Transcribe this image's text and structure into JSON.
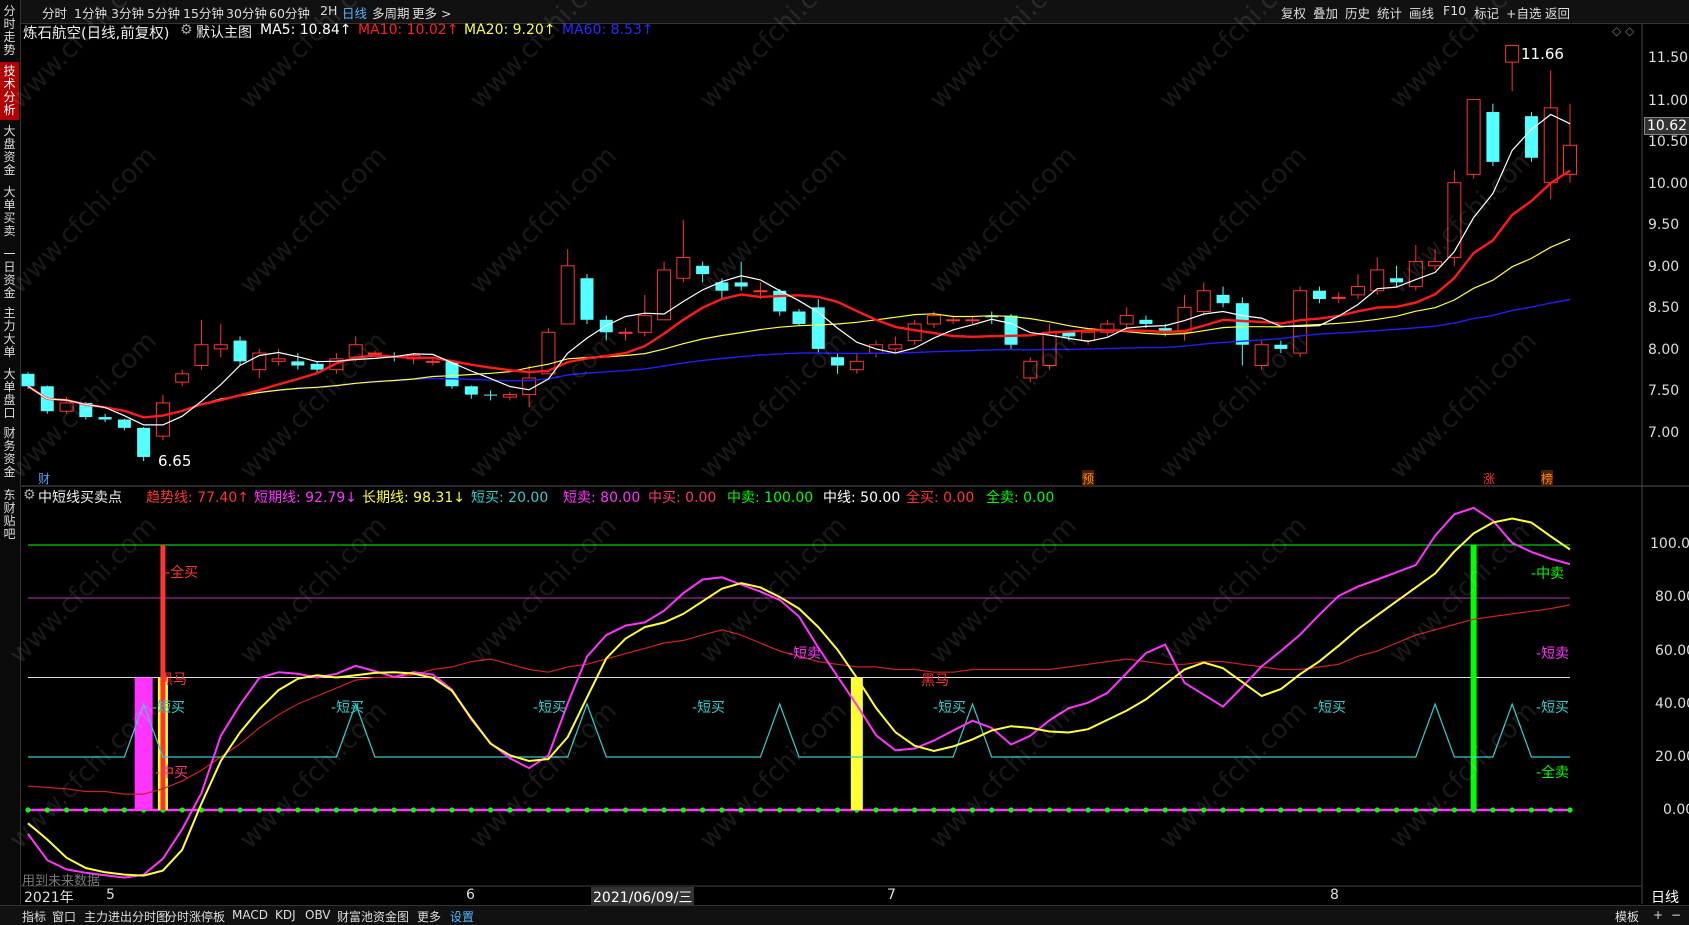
{
  "toolbar": {
    "items": [
      {
        "label": "分时"
      },
      {
        "label": "1分钟"
      },
      {
        "label": "3分钟"
      },
      {
        "label": "5分钟"
      },
      {
        "label": "15分钟"
      },
      {
        "label": "30分钟"
      },
      {
        "label": "60分钟"
      },
      {
        "label": "2H"
      },
      {
        "label": "日线"
      },
      {
        "label": "多周期"
      },
      {
        "label": "更多 >"
      }
    ],
    "right_items": [
      {
        "label": "复权"
      },
      {
        "label": "叠加"
      },
      {
        "label": "历史"
      },
      {
        "label": "统计"
      },
      {
        "label": "画线"
      },
      {
        "label": "F10"
      },
      {
        "label": "标记"
      },
      {
        "label": "+自选"
      },
      {
        "label": "返回"
      }
    ]
  },
  "sidebar": {
    "tabs": [
      {
        "label": "分时走势"
      },
      {
        "label": "技术分析"
      },
      {
        "label": "大盘资金"
      },
      {
        "label": "大单买卖"
      },
      {
        "label": "一日资金"
      },
      {
        "label": "主力大单"
      },
      {
        "label": "大单盘口"
      },
      {
        "label": "财务资金"
      },
      {
        "label": "东财贴吧"
      }
    ]
  },
  "main_chart": {
    "stock_name": "炼石航空(日线,前复权)",
    "indicator_name": "默认主图",
    "ma5": "MA5: 10.84↑",
    "ma10": "MA10: 10.02↑",
    "ma20": "MA20: 9.20↑",
    "ma60": "MA60: 8.53↑",
    "high_label": "11.66",
    "low_label": "6.65",
    "current_price": "10.62",
    "markers": [
      "财",
      "预",
      "涨",
      "榜"
    ],
    "y_ticks": [
      "11.50",
      "11.00",
      "10.50",
      "10.00",
      "9.50",
      "9.00",
      "8.50",
      "8.00",
      "7.50",
      "7.00"
    ]
  },
  "sub_chart": {
    "name": "中短线买卖点",
    "trend": "趋势线: 77.40↑",
    "short": "短期线: 92.79↓",
    "long": "长期线: 98.31↓",
    "short_buy": "短买: 20.00",
    "short_sell": "短卖: 80.00",
    "mid_buy": "中买: 0.00",
    "mid_sell": "中卖: 100.00",
    "mid_line": "中线: 50.00",
    "all_buy": "全买: 0.00",
    "all_sell": "全卖: 0.00",
    "y_ticks": [
      "100.00",
      "80.00",
      "60.00",
      "40.00",
      "20.00",
      "0.00"
    ],
    "annotations": {
      "quanmai": "全买",
      "heima": "黑马",
      "duanmai": "短买",
      "zhongmai": "中买",
      "duanmai_mai": "短卖",
      "zhongmai_mai": "中卖",
      "quanmai_mai": "全卖"
    },
    "future_note": "用到未来数据"
  },
  "x_axis": {
    "labels": [
      "2021年",
      "5",
      "6",
      "2021/06/09/三",
      "7",
      "8"
    ]
  },
  "bottom_tabs": [
    {
      "label": "指标"
    },
    {
      "label": "窗口"
    },
    {
      "label": "主力进出分时图"
    },
    {
      "label": "分时涨停板"
    },
    {
      "label": "MACD"
    },
    {
      "label": "KDJ"
    },
    {
      "label": "OBV"
    },
    {
      "label": "财富池资金图"
    },
    {
      "label": "更多"
    },
    {
      "label": "设置"
    }
  ],
  "bottom_right": {
    "template": "模板",
    "period": "日线",
    "plus": "+",
    "minus": "−"
  },
  "colors": {
    "up": "#ff3232",
    "down": "#54ffff",
    "ma5": "#ffffff",
    "ma10": "#ff1a1a",
    "ma20": "#ffff33",
    "ma60": "#1e1eff",
    "trend": "#ff3333",
    "short": "#ff33ff",
    "long": "#ffff33",
    "cyan": "#33cccc",
    "green": "#00ff00",
    "magenta_line": "#c030c0"
  },
  "chart_data": {
    "type": "candlestick",
    "price_range": [
      6.6,
      11.75
    ],
    "candles": [
      [
        7.7,
        7.55,
        7.72,
        7.52
      ],
      [
        7.55,
        7.25,
        7.56,
        7.22
      ],
      [
        7.25,
        7.35,
        7.42,
        7.22
      ],
      [
        7.35,
        7.18,
        7.36,
        7.15
      ],
      [
        7.18,
        7.15,
        7.22,
        7.12
      ],
      [
        7.15,
        7.05,
        7.16,
        7.02
      ],
      [
        7.05,
        6.7,
        7.06,
        6.65
      ],
      [
        6.95,
        7.35,
        7.45,
        6.9
      ],
      [
        7.6,
        7.7,
        7.75,
        7.55
      ],
      [
        7.8,
        8.05,
        8.35,
        7.75
      ],
      [
        8.0,
        8.05,
        8.3,
        7.9
      ],
      [
        8.1,
        7.85,
        8.15,
        7.8
      ],
      [
        7.75,
        7.95,
        8.0,
        7.65
      ],
      [
        7.85,
        7.88,
        8.0,
        7.8
      ],
      [
        7.85,
        7.8,
        7.95,
        7.75
      ],
      [
        7.82,
        7.75,
        7.85,
        7.7
      ],
      [
        7.75,
        7.88,
        7.95,
        7.7
      ],
      [
        7.9,
        8.05,
        8.15,
        7.85
      ],
      [
        7.95,
        7.95,
        7.98,
        7.9
      ],
      [
        7.92,
        7.9,
        7.96,
        7.85
      ],
      [
        7.88,
        7.92,
        7.95,
        7.82
      ],
      [
        7.85,
        7.85,
        7.88,
        7.8
      ],
      [
        7.85,
        7.55,
        7.86,
        7.52
      ],
      [
        7.55,
        7.45,
        7.56,
        7.4
      ],
      [
        7.45,
        7.44,
        7.5,
        7.38
      ],
      [
        7.42,
        7.45,
        7.48,
        7.38
      ],
      [
        7.45,
        7.65,
        7.8,
        7.3
      ],
      [
        7.7,
        8.2,
        8.25,
        7.7
      ],
      [
        8.3,
        9.0,
        9.2,
        8.3
      ],
      [
        8.85,
        8.35,
        8.9,
        8.3
      ],
      [
        8.35,
        8.2,
        8.4,
        8.1
      ],
      [
        8.2,
        8.2,
        8.25,
        8.1
      ],
      [
        8.2,
        8.4,
        8.65,
        8.15
      ],
      [
        8.35,
        8.95,
        9.05,
        8.35
      ],
      [
        8.85,
        9.1,
        9.55,
        8.8
      ],
      [
        9.0,
        8.9,
        9.05,
        8.8
      ],
      [
        8.8,
        8.7,
        8.85,
        8.6
      ],
      [
        8.8,
        8.75,
        9.05,
        8.7
      ],
      [
        8.7,
        8.7,
        8.8,
        8.6
      ],
      [
        8.7,
        8.45,
        8.72,
        8.4
      ],
      [
        8.45,
        8.3,
        8.48,
        8.28
      ],
      [
        8.5,
        8.0,
        8.6,
        7.95
      ],
      [
        7.9,
        7.8,
        7.95,
        7.7
      ],
      [
        7.75,
        7.85,
        7.95,
        7.7
      ],
      [
        7.95,
        8.05,
        8.1,
        7.9
      ],
      [
        8.0,
        8.05,
        8.15,
        7.95
      ],
      [
        8.1,
        8.3,
        8.35,
        8.05
      ],
      [
        8.3,
        8.4,
        8.45,
        8.25
      ],
      [
        8.35,
        8.35,
        8.4,
        8.3
      ],
      [
        8.35,
        8.35,
        8.4,
        8.3
      ],
      [
        8.4,
        8.38,
        8.45,
        8.3
      ],
      [
        8.4,
        8.05,
        8.42,
        8.0
      ],
      [
        7.65,
        7.85,
        7.9,
        7.6
      ],
      [
        7.8,
        8.2,
        8.3,
        7.75
      ],
      [
        8.2,
        8.15,
        8.22,
        8.1
      ],
      [
        8.1,
        8.2,
        8.25,
        8.05
      ],
      [
        8.2,
        8.3,
        8.35,
        8.15
      ],
      [
        8.3,
        8.4,
        8.5,
        8.25
      ],
      [
        8.35,
        8.3,
        8.4,
        8.25
      ],
      [
        8.25,
        8.2,
        8.3,
        8.15
      ],
      [
        8.2,
        8.5,
        8.65,
        8.1
      ],
      [
        8.45,
        8.7,
        8.8,
        8.4
      ],
      [
        8.65,
        8.55,
        8.75,
        8.5
      ],
      [
        8.55,
        8.05,
        8.62,
        7.8
      ],
      [
        7.8,
        8.05,
        8.1,
        7.75
      ],
      [
        8.05,
        8.0,
        8.1,
        7.95
      ],
      [
        7.95,
        8.7,
        8.75,
        7.9
      ],
      [
        8.7,
        8.6,
        8.75,
        8.55
      ],
      [
        8.62,
        8.62,
        8.68,
        8.55
      ],
      [
        8.65,
        8.75,
        8.9,
        8.6
      ],
      [
        8.7,
        8.95,
        9.1,
        8.65
      ],
      [
        8.85,
        8.8,
        9.0,
        8.75
      ],
      [
        8.75,
        9.05,
        9.25,
        8.7
      ],
      [
        9.0,
        9.05,
        9.2,
        8.95
      ],
      [
        9.1,
        10.0,
        10.15,
        9.0
      ],
      [
        10.1,
        11.0,
        11.0,
        10.05
      ],
      [
        10.85,
        10.25,
        10.95,
        10.2
      ],
      [
        11.45,
        11.65,
        11.66,
        11.1
      ],
      [
        10.8,
        10.3,
        10.85,
        10.25
      ],
      [
        10.0,
        10.9,
        11.35,
        9.8
      ],
      [
        10.1,
        10.45,
        10.95,
        10.0
      ]
    ]
  }
}
